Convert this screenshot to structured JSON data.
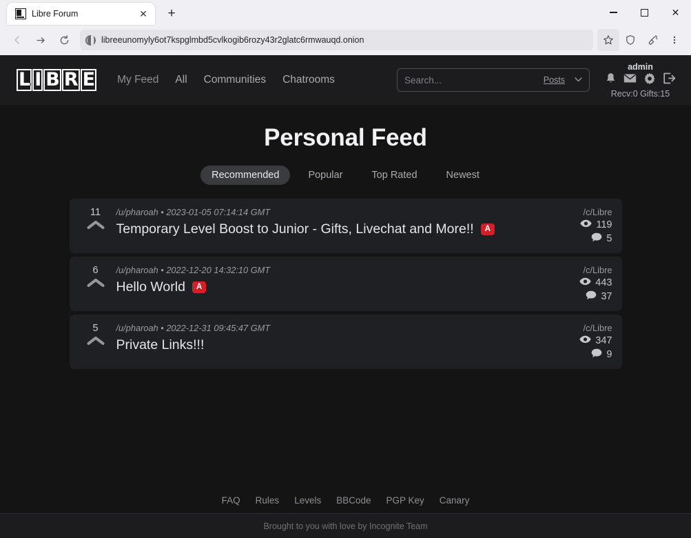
{
  "browser": {
    "tab": {
      "title": "Libre Forum",
      "favicon": "libre-favicon",
      "close": "✕"
    },
    "new_tab": "+",
    "window_controls": {
      "minimize": "minimize",
      "maximize": "maximize",
      "close": "✕"
    },
    "back": "←",
    "forward": "→",
    "reload": "reload",
    "url": "libreeunomyly6ot7kspglmbd5cvlkogib6rozy43r2glatc6rmwauqd.onion",
    "toolbar_icons": [
      "star-icon",
      "shield-icon",
      "broom-icon",
      "menu-icon"
    ]
  },
  "site": {
    "logo": {
      "letters": [
        "L",
        "I",
        "B",
        "R",
        "E"
      ]
    },
    "nav": [
      {
        "label": "My Feed",
        "active": true
      },
      {
        "label": "All",
        "active": false
      },
      {
        "label": "Communities",
        "active": false
      },
      {
        "label": "Chatrooms",
        "active": false
      }
    ],
    "search": {
      "placeholder": "Search...",
      "scope": "Posts",
      "chevron": "⌄"
    },
    "user": {
      "name": "admin",
      "icons": [
        "bell-icon",
        "envelope-icon",
        "gear-icon",
        "logout-icon"
      ],
      "stats": "Recv:0  Gifts:15"
    }
  },
  "main": {
    "title": "Personal Feed",
    "tabs": [
      {
        "label": "Recommended",
        "active": true
      },
      {
        "label": "Popular",
        "active": false
      },
      {
        "label": "Top Rated",
        "active": false
      },
      {
        "label": "Newest",
        "active": false
      }
    ],
    "posts": [
      {
        "score": "11",
        "author": "/u/pharoah",
        "separator": "•",
        "date": "2023-01-05 07:14:14 GMT",
        "title": "Temporary Level Boost to Junior - Gifts, Livechat and More!!",
        "badge": "A",
        "community": "/c/Libre",
        "views": "119",
        "comments": "5"
      },
      {
        "score": "6",
        "author": "/u/pharoah",
        "separator": "•",
        "date": "2022-12-20 14:32:10 GMT",
        "title": "Hello World",
        "badge": "A",
        "community": "/c/Libre",
        "views": "443",
        "comments": "37"
      },
      {
        "score": "5",
        "author": "/u/pharoah",
        "separator": "•",
        "date": "2022-12-31 09:45:47 GMT",
        "title": "Private Links!!!",
        "badge": "",
        "community": "/c/Libre",
        "views": "347",
        "comments": "9"
      }
    ]
  },
  "footer": {
    "links": [
      "FAQ",
      "Rules",
      "Levels",
      "BBCode",
      "PGP Key",
      "Canary"
    ],
    "credit": "Brought to you with love by Incognite Team"
  },
  "colors": {
    "page_bg": "#141414",
    "header_bg": "#1c1c1e",
    "card_bg": "#1f2023",
    "badge_red": "#d32028",
    "active_tab_bg": "#3a3b3f"
  }
}
